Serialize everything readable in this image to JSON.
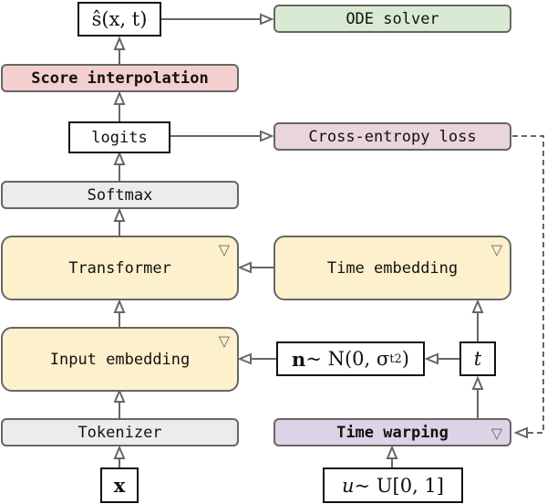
{
  "nodes": {
    "score_output": "ŝ(x, t)",
    "ode_solver": "ODE solver",
    "score_interpolation": "Score interpolation",
    "logits": "logits",
    "cross_entropy_loss": "Cross-entropy loss",
    "softmax": "Softmax",
    "transformer": "Transformer",
    "time_embedding": "Time embedding",
    "input_embedding": "Input embedding",
    "noise": "n ~ N(0, σt²)",
    "noise_parts": {
      "n": "n",
      "rest": " ~ N(0, σ",
      "sub": "t",
      "sup": "2",
      "close": ")"
    },
    "t": "t",
    "tokenizer": "Tokenizer",
    "time_warping": "Time warping",
    "x": "x",
    "u_sample": "u ~ U[0, 1]",
    "u_parts": {
      "u": "u",
      "rest": " ~ U[0, 1]"
    }
  },
  "icons": {
    "trainable": "▽"
  },
  "colors": {
    "gray": "#ececec",
    "yellow": "#fdf0cc",
    "pink": "#f3cfd0",
    "light_pink": "#ead4dd",
    "green": "#d9ead3",
    "purple": "#dcd3e6",
    "edge": "#666666"
  }
}
